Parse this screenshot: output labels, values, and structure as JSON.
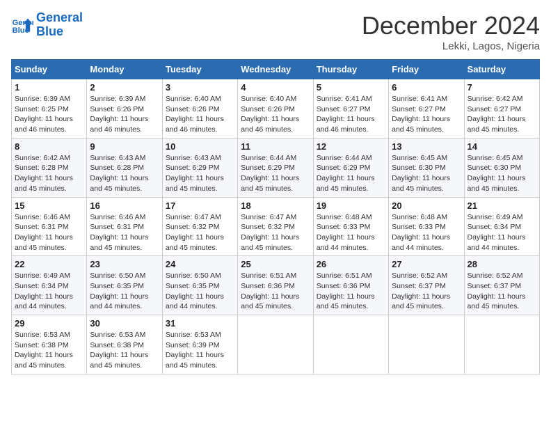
{
  "header": {
    "logo_line1": "General",
    "logo_line2": "Blue",
    "month_title": "December 2024",
    "location": "Lekki, Lagos, Nigeria"
  },
  "weekdays": [
    "Sunday",
    "Monday",
    "Tuesday",
    "Wednesday",
    "Thursday",
    "Friday",
    "Saturday"
  ],
  "weeks": [
    [
      {
        "day": "1",
        "sunrise": "6:39 AM",
        "sunset": "6:25 PM",
        "daylight": "11 hours and 46 minutes."
      },
      {
        "day": "2",
        "sunrise": "6:39 AM",
        "sunset": "6:26 PM",
        "daylight": "11 hours and 46 minutes."
      },
      {
        "day": "3",
        "sunrise": "6:40 AM",
        "sunset": "6:26 PM",
        "daylight": "11 hours and 46 minutes."
      },
      {
        "day": "4",
        "sunrise": "6:40 AM",
        "sunset": "6:26 PM",
        "daylight": "11 hours and 46 minutes."
      },
      {
        "day": "5",
        "sunrise": "6:41 AM",
        "sunset": "6:27 PM",
        "daylight": "11 hours and 46 minutes."
      },
      {
        "day": "6",
        "sunrise": "6:41 AM",
        "sunset": "6:27 PM",
        "daylight": "11 hours and 45 minutes."
      },
      {
        "day": "7",
        "sunrise": "6:42 AM",
        "sunset": "6:27 PM",
        "daylight": "11 hours and 45 minutes."
      }
    ],
    [
      {
        "day": "8",
        "sunrise": "6:42 AM",
        "sunset": "6:28 PM",
        "daylight": "11 hours and 45 minutes."
      },
      {
        "day": "9",
        "sunrise": "6:43 AM",
        "sunset": "6:28 PM",
        "daylight": "11 hours and 45 minutes."
      },
      {
        "day": "10",
        "sunrise": "6:43 AM",
        "sunset": "6:29 PM",
        "daylight": "11 hours and 45 minutes."
      },
      {
        "day": "11",
        "sunrise": "6:44 AM",
        "sunset": "6:29 PM",
        "daylight": "11 hours and 45 minutes."
      },
      {
        "day": "12",
        "sunrise": "6:44 AM",
        "sunset": "6:29 PM",
        "daylight": "11 hours and 45 minutes."
      },
      {
        "day": "13",
        "sunrise": "6:45 AM",
        "sunset": "6:30 PM",
        "daylight": "11 hours and 45 minutes."
      },
      {
        "day": "14",
        "sunrise": "6:45 AM",
        "sunset": "6:30 PM",
        "daylight": "11 hours and 45 minutes."
      }
    ],
    [
      {
        "day": "15",
        "sunrise": "6:46 AM",
        "sunset": "6:31 PM",
        "daylight": "11 hours and 45 minutes."
      },
      {
        "day": "16",
        "sunrise": "6:46 AM",
        "sunset": "6:31 PM",
        "daylight": "11 hours and 45 minutes."
      },
      {
        "day": "17",
        "sunrise": "6:47 AM",
        "sunset": "6:32 PM",
        "daylight": "11 hours and 45 minutes."
      },
      {
        "day": "18",
        "sunrise": "6:47 AM",
        "sunset": "6:32 PM",
        "daylight": "11 hours and 45 minutes."
      },
      {
        "day": "19",
        "sunrise": "6:48 AM",
        "sunset": "6:33 PM",
        "daylight": "11 hours and 44 minutes."
      },
      {
        "day": "20",
        "sunrise": "6:48 AM",
        "sunset": "6:33 PM",
        "daylight": "11 hours and 44 minutes."
      },
      {
        "day": "21",
        "sunrise": "6:49 AM",
        "sunset": "6:34 PM",
        "daylight": "11 hours and 44 minutes."
      }
    ],
    [
      {
        "day": "22",
        "sunrise": "6:49 AM",
        "sunset": "6:34 PM",
        "daylight": "11 hours and 44 minutes."
      },
      {
        "day": "23",
        "sunrise": "6:50 AM",
        "sunset": "6:35 PM",
        "daylight": "11 hours and 44 minutes."
      },
      {
        "day": "24",
        "sunrise": "6:50 AM",
        "sunset": "6:35 PM",
        "daylight": "11 hours and 44 minutes."
      },
      {
        "day": "25",
        "sunrise": "6:51 AM",
        "sunset": "6:36 PM",
        "daylight": "11 hours and 45 minutes."
      },
      {
        "day": "26",
        "sunrise": "6:51 AM",
        "sunset": "6:36 PM",
        "daylight": "11 hours and 45 minutes."
      },
      {
        "day": "27",
        "sunrise": "6:52 AM",
        "sunset": "6:37 PM",
        "daylight": "11 hours and 45 minutes."
      },
      {
        "day": "28",
        "sunrise": "6:52 AM",
        "sunset": "6:37 PM",
        "daylight": "11 hours and 45 minutes."
      }
    ],
    [
      {
        "day": "29",
        "sunrise": "6:53 AM",
        "sunset": "6:38 PM",
        "daylight": "11 hours and 45 minutes."
      },
      {
        "day": "30",
        "sunrise": "6:53 AM",
        "sunset": "6:38 PM",
        "daylight": "11 hours and 45 minutes."
      },
      {
        "day": "31",
        "sunrise": "6:53 AM",
        "sunset": "6:39 PM",
        "daylight": "11 hours and 45 minutes."
      },
      null,
      null,
      null,
      null
    ]
  ]
}
